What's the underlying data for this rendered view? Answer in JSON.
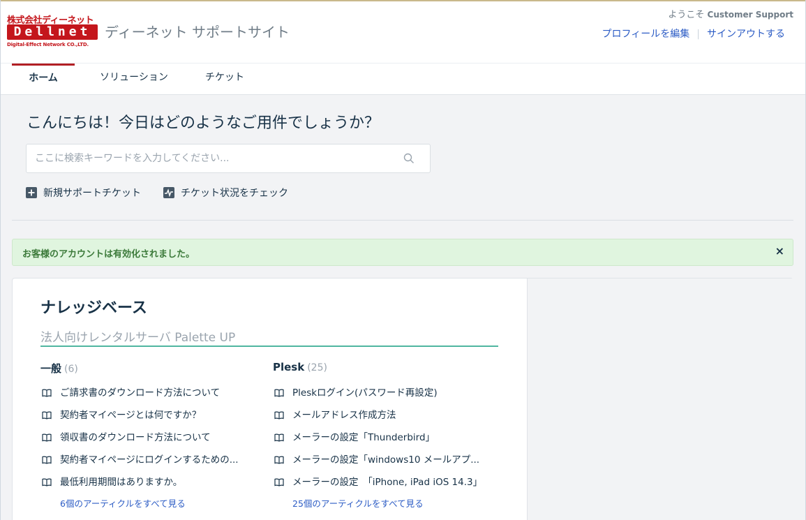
{
  "header": {
    "logo_company": "株式会社ディーネット",
    "logo_mark": "Dellnet",
    "logo_sub": "Digital-Effect Network CO.,LTD.",
    "site_title": "ディーネット サポートサイト",
    "welcome_prefix": "ようこそ",
    "user_name": "Customer Support",
    "edit_profile": "プロフィールを編集",
    "sign_out": "サインアウトする"
  },
  "nav": {
    "tabs": [
      {
        "label": "ホーム"
      },
      {
        "label": "ソリューション"
      },
      {
        "label": "チケット"
      }
    ]
  },
  "hero": {
    "title": "こんにちは！今日はどのようなご用件でしょうか？",
    "search_placeholder": "ここに検索キーワードを入力してください...",
    "new_ticket": "新規サポートチケット",
    "check_status": "チケット状況をチェック"
  },
  "alert": {
    "message": "お客様のアカウントは有効化されました。",
    "close": "×"
  },
  "kb": {
    "title": "ナレッジベース",
    "subtitle": "法人向けレンタルサーバ Palette UP",
    "folders": [
      {
        "name": "一般",
        "count": "(6)",
        "articles": [
          "ご請求書のダウンロード方法について",
          "契約者マイページとは何ですか？",
          "領収書のダウンロード方法について",
          "契約者マイページにログインするための...",
          "最低利用期間はありますか。"
        ],
        "see_all": "6個のアーティクルをすべて見る"
      },
      {
        "name": "Plesk",
        "count": "(25)",
        "articles": [
          "Pleskログイン(パスワード再設定)",
          "メールアドレス作成方法",
          "メーラーの設定「Thunderbird」",
          "メーラーの設定「windows10 メールアプ...",
          "メーラーの設定　「iPhone, iPad iOS 14.3」"
        ],
        "see_all": "25個のアーティクルをすべて見る"
      }
    ]
  }
}
